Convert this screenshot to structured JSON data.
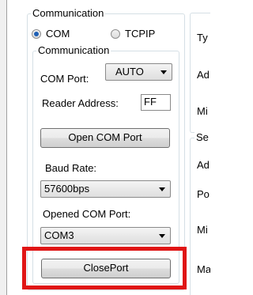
{
  "communication": {
    "outer_legend": "Communication",
    "radio_com": "COM",
    "radio_tcpip": "TCPIP",
    "inner_legend": "Communication",
    "com_port_label": "COM Port:",
    "com_port_value": "AUTO",
    "reader_address_label": "Reader Address:",
    "reader_address_value": "FF",
    "open_button": "Open COM Port",
    "baud_rate_label": "Baud Rate:",
    "baud_rate_value": "57600bps",
    "opened_port_label": "Opened COM Port:",
    "opened_port_value": "COM3",
    "close_button": "ClosePort"
  },
  "right_panel": {
    "top_labels": [
      "Ty",
      "Ad",
      "Mi"
    ],
    "bottom_legend": "Se",
    "bottom_labels": [
      "Ad",
      "Po",
      "Mi",
      "Ma"
    ]
  },
  "selected_connection": "COM",
  "highlight_color": "#e01515"
}
